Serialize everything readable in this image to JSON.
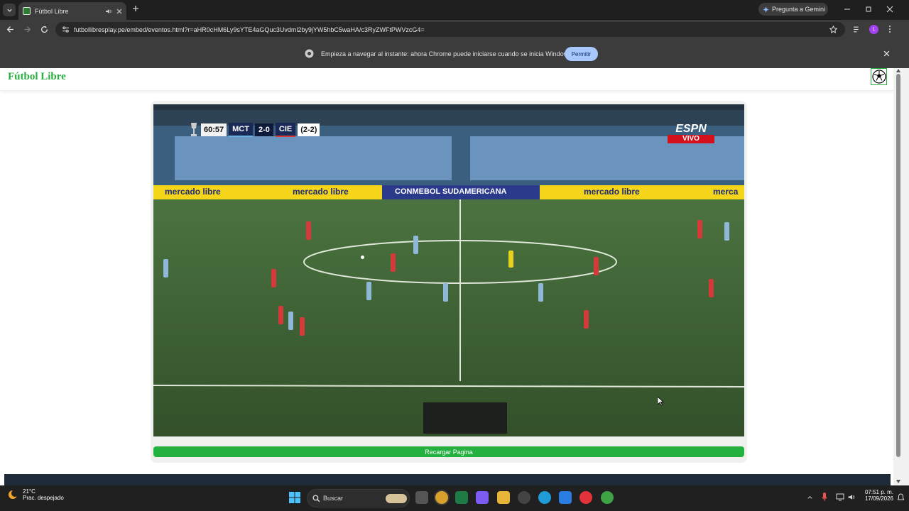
{
  "browser": {
    "tab_title": "Fútbol Libre",
    "url": "futbollibresplay.pe/embed/eventos.html?r=aHR0cHM6Ly9sYTE4aGQuc3Uvdml2by9jYW5hbC5waHA/c3RyZWFtPWVzcG4=",
    "gemini_label": "Pregunta a Gemini",
    "profile_initial": "L",
    "infobar_text": "Empieza a navegar al instante: ahora Chrome puede iniciarse cuando se inicia Windows.",
    "infobar_button": "Permitir"
  },
  "site": {
    "brand": "Fútbol Libre",
    "reload_button": "Recargar Pagina"
  },
  "video": {
    "clock": "60:57",
    "home_team": "MCT",
    "score": "2-0",
    "away_team": "CIE",
    "aggregate": "(2-2)",
    "network": "ESPN",
    "live_badge": "VIVO",
    "board_texts": [
      "mercado libre",
      "mercado libre",
      "CONMEBOL SUDAMERICANA",
      "mercado libre",
      "merca"
    ]
  },
  "taskbar": {
    "weather_temp": "21°C",
    "weather_desc": "Prac. despejado",
    "search_placeholder": "Buscar",
    "time": "07:51 p. m.",
    "date": "17/09/2026"
  },
  "colors": {
    "brand_green": "#27ae3f",
    "button_green": "#22b03e",
    "chrome_dark": "#3c3c3c",
    "taskbar": "#202020"
  }
}
